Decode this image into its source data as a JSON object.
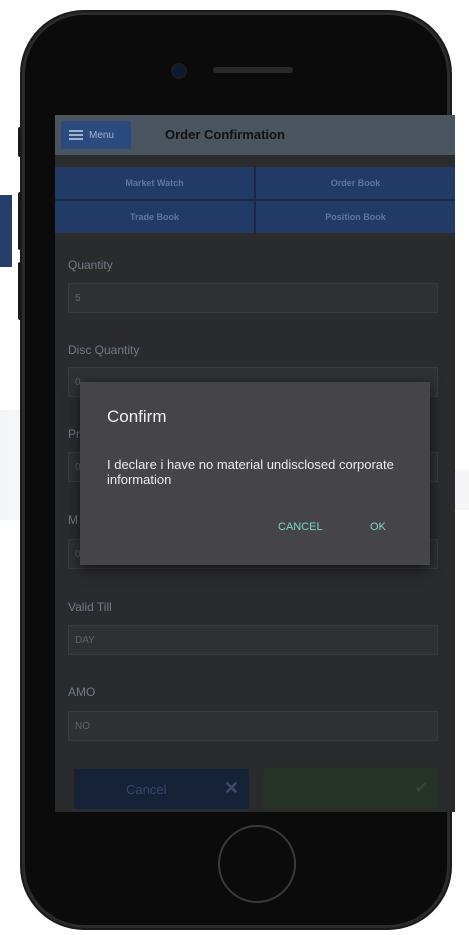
{
  "header": {
    "menu_label": "Menu",
    "title": "Order Confirmation"
  },
  "nav": {
    "items": [
      "Market Watch",
      "Order Book",
      "Trade Book",
      "Position Book"
    ]
  },
  "form": {
    "quantity": {
      "label": "Quantity",
      "value": "5"
    },
    "disc_quantity": {
      "label": "Disc Quantity",
      "value": "0"
    },
    "price": {
      "label": "Pr",
      "value": "0"
    },
    "m_field": {
      "label": "M",
      "value": "0"
    },
    "valid_till": {
      "label": "Valid Till",
      "value": "DAY"
    },
    "amo": {
      "label": "AMO",
      "value": "NO"
    }
  },
  "actions": {
    "cancel_label": "Cancel",
    "cancel_icon": "close-icon",
    "submit_icon": "check-icon"
  },
  "dialog": {
    "title": "Confirm",
    "message": "I declare i have no material undisclosed corporate information",
    "cancel_label": "CANCEL",
    "ok_label": "OK"
  },
  "colors": {
    "accent": "#7ed3c6",
    "nav_blue": "#213b66"
  }
}
